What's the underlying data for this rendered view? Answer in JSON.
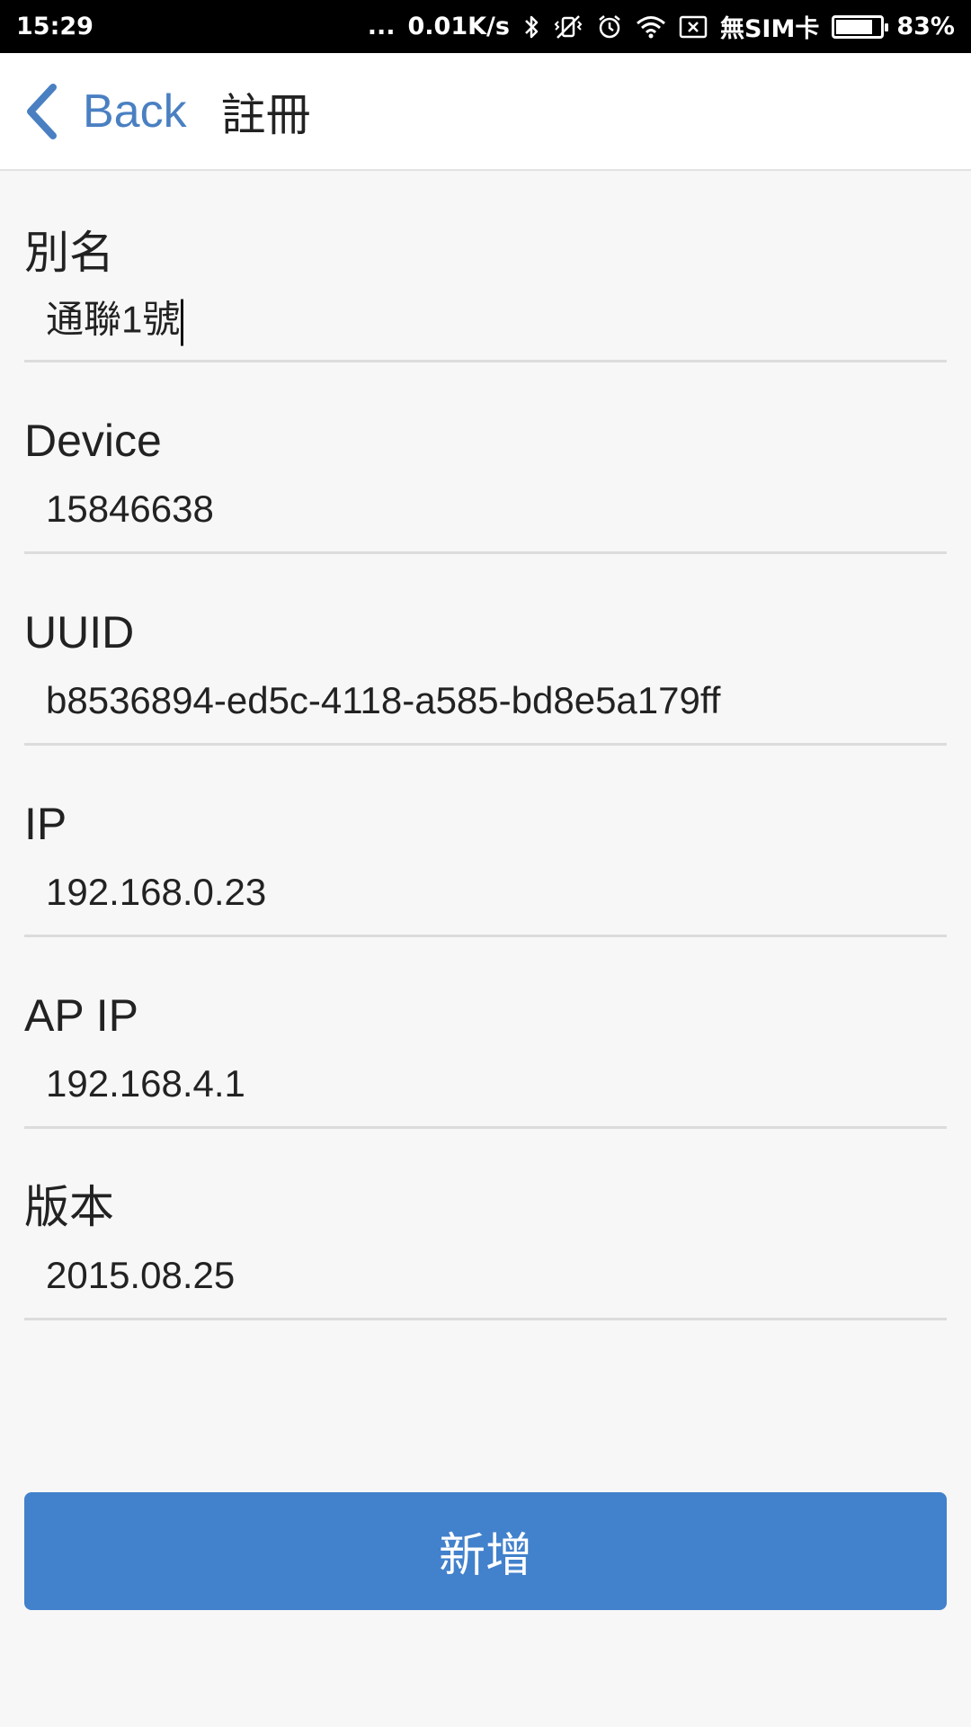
{
  "status_bar": {
    "time": "15:29",
    "dots": "...",
    "speed": "0.01K/s",
    "sim": "無SIM卡",
    "battery_percent": "83%",
    "battery_level": 0.83,
    "icons": [
      "bluetooth-icon",
      "vibrate-icon",
      "alarm-icon",
      "wifi-icon",
      "no-sim-icon",
      "battery-icon"
    ]
  },
  "header": {
    "back_label": "Back",
    "title": "註冊"
  },
  "fields": [
    {
      "label": "別名",
      "value": "通聯1號"
    },
    {
      "label": "Device",
      "value": "15846638"
    },
    {
      "label": "UUID",
      "value": "b8536894-ed5c-4118-a585-bd8e5a179ff"
    },
    {
      "label": "IP",
      "value": "192.168.0.23"
    },
    {
      "label": "AP IP",
      "value": "192.168.4.1"
    },
    {
      "label": "版本",
      "value": "2015.08.25"
    }
  ],
  "button": {
    "label": "新增"
  },
  "colors": {
    "accent": "#4a80c2",
    "button": "#4281cc",
    "background": "#f7f7f7",
    "divider": "#dcdcdc"
  }
}
